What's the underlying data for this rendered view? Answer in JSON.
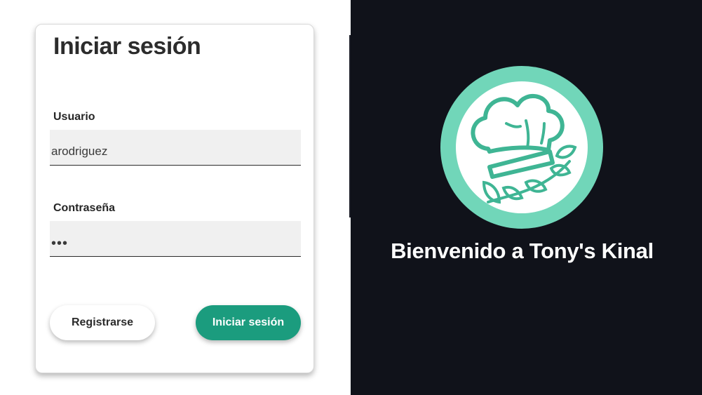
{
  "login": {
    "title": "Iniciar sesión",
    "username_label": "Usuario",
    "username_value": "arodriguez",
    "password_label": "Contraseña",
    "password_value": "•••",
    "register_button": "Registrarse",
    "login_button": "Iniciar sesión"
  },
  "welcome": {
    "message": "Bienvenido a Tony's Kinal",
    "logo_icon": "chef-hat-icon"
  },
  "colors": {
    "accent": "#1b9c7e",
    "logo_ring": "#6fd1b7",
    "dark_background": "#10121a"
  }
}
